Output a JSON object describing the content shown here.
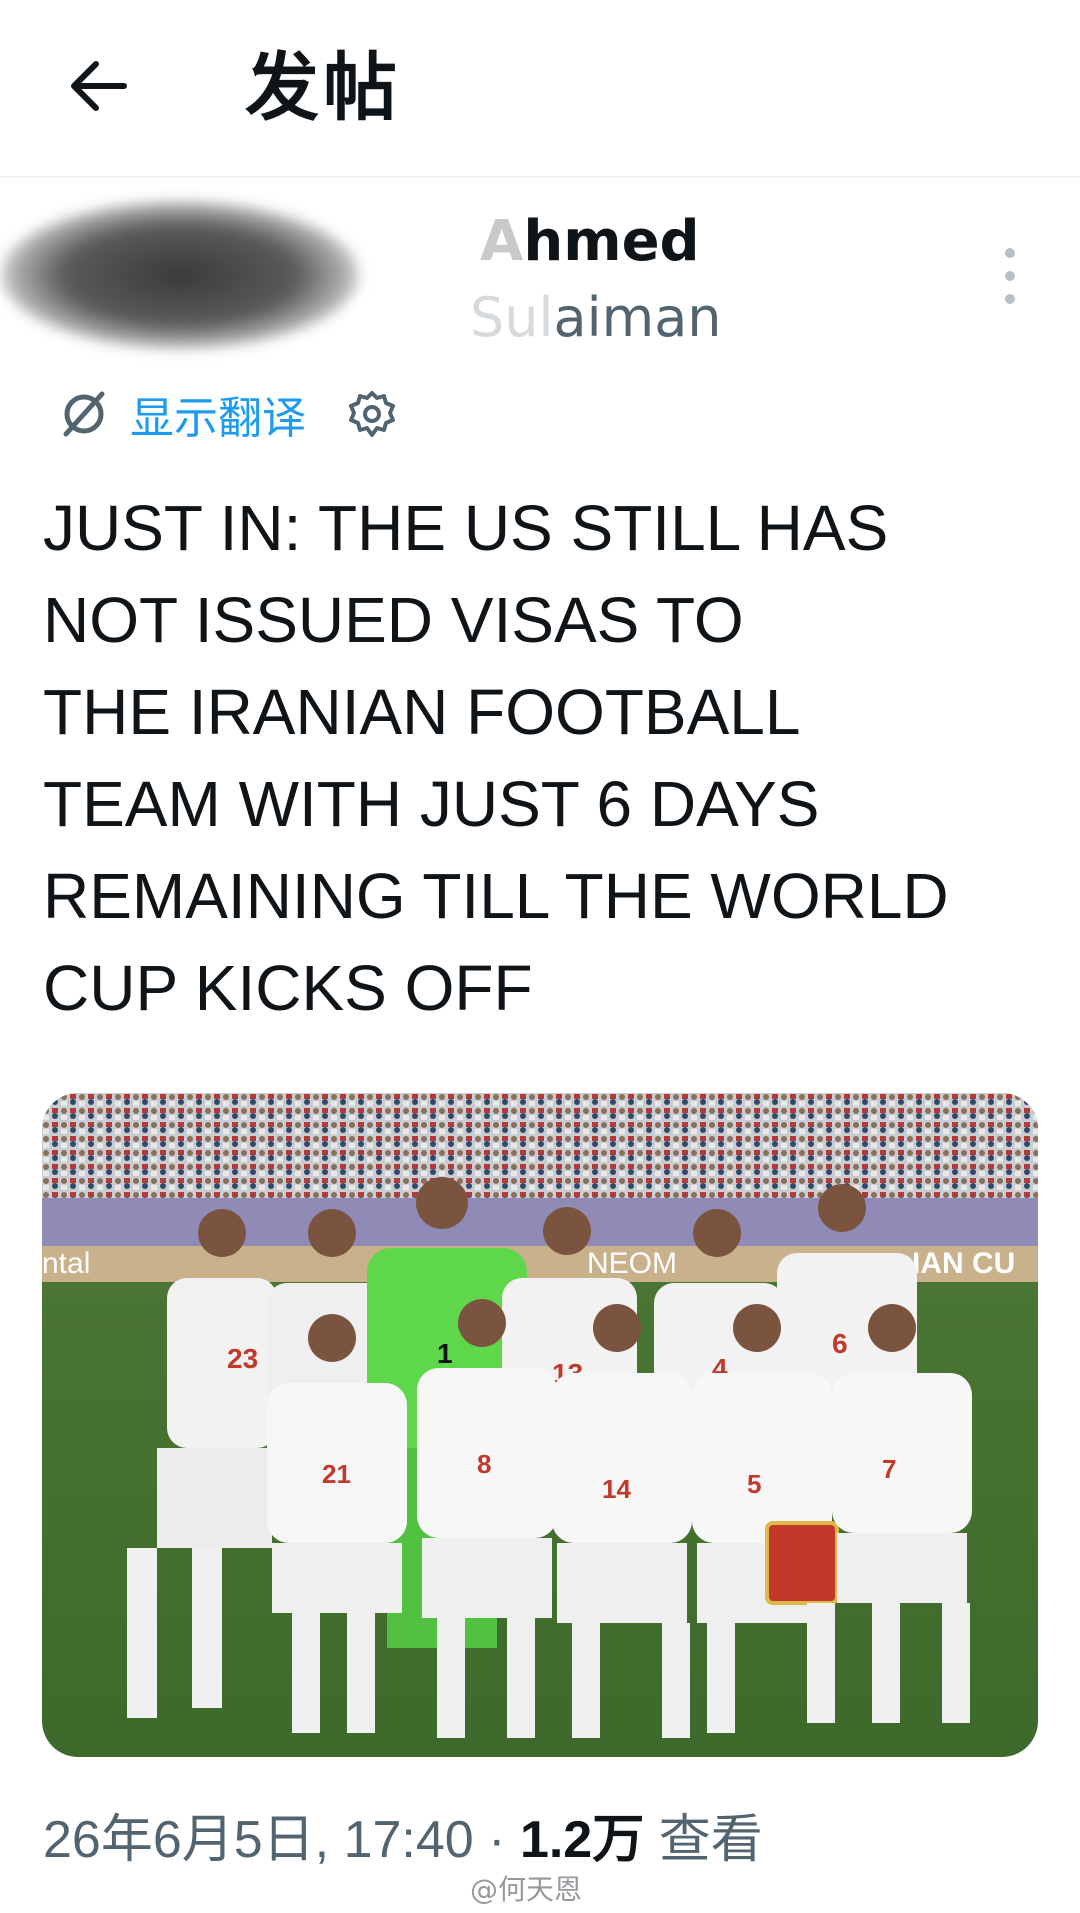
{
  "header": {
    "back_icon": "arrow-left-icon",
    "title": "发帖"
  },
  "author": {
    "display_name_faded": "A",
    "display_name_visible": "hmed",
    "handle_faded": "Sul",
    "handle_visible": "aiman"
  },
  "post": {
    "translate_label": "显示翻译",
    "translate_icon": "translate-icon",
    "settings_icon": "gear-icon",
    "text": "JUST IN: THE US STILL HAS\nNOT ISSUED VISAS TO\nTHE IRANIAN FOOTBALL\nTEAM WITH JUST 6 DAYS\nREMAINING TILL THE WORLD\nCUP KICKS OFF"
  },
  "photo": {
    "description_icon": "team-photo-image",
    "stadium_banners": [
      "ntal",
      "NEOM",
      "IAN CU"
    ],
    "jersey_numbers_back": [
      "23",
      "1",
      "13",
      "4",
      "6"
    ],
    "jersey_numbers_front": [
      "21",
      "8",
      "14",
      "5",
      "7"
    ]
  },
  "meta": {
    "timestamp": "26年6月5日, 17:40",
    "separator": "·",
    "views_count": "1.2万",
    "views_label": "查看"
  },
  "watermark": "@何天恩",
  "colors": {
    "accent": "#1d9bf0",
    "text": "#0f1419",
    "secondary": "#536471"
  }
}
